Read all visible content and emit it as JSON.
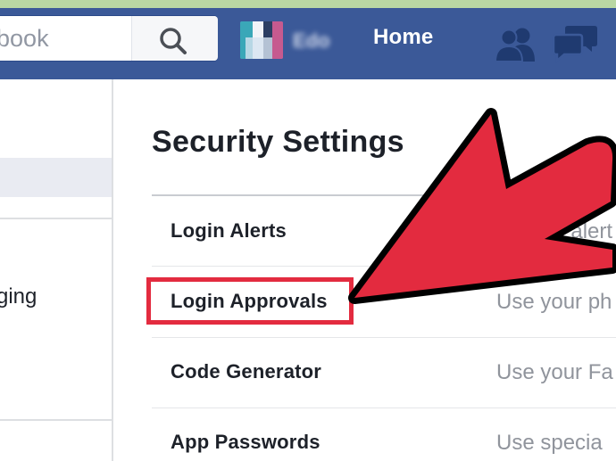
{
  "header": {
    "search_placeholder": "ebook",
    "profile_name": "Edo",
    "home_label": "Home"
  },
  "sidebar": {
    "items": [
      {
        "label": "ging"
      }
    ]
  },
  "main": {
    "title": "Security Settings",
    "settings": [
      {
        "label": "Login Alerts",
        "description": "an alert"
      },
      {
        "label": "Login Approvals",
        "description": "Use your ph"
      },
      {
        "label": "Code Generator",
        "description": "Use your Fa"
      },
      {
        "label": "App Passwords",
        "description": "Use specia"
      }
    ]
  },
  "colors": {
    "header_blue": "#3b5998",
    "annotation_red": "#e32b3f"
  }
}
